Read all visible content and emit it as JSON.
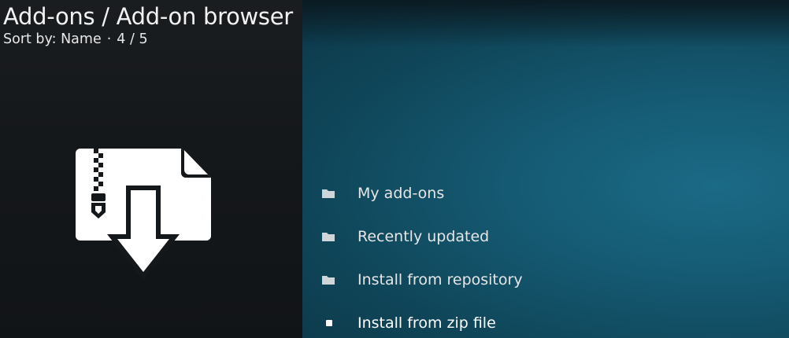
{
  "header": {
    "title": "Add-ons / Add-on browser",
    "sort_label": "Sort by: Name",
    "position": "4 / 5"
  },
  "thumbnail": {
    "icon": "zip-install-icon",
    "color": "#ffffff"
  },
  "menu": {
    "items": [
      {
        "label": "My add-ons",
        "icon": "folder-icon"
      },
      {
        "label": "Recently updated",
        "icon": "folder-icon"
      },
      {
        "label": "Install from repository",
        "icon": "folder-icon"
      },
      {
        "label": "Install from zip file",
        "icon": "square-bullet-icon",
        "focused": true
      }
    ]
  },
  "colors": {
    "left_bg": "#15181b",
    "right_bg": "#155a73",
    "text": "#e6e6e6"
  }
}
